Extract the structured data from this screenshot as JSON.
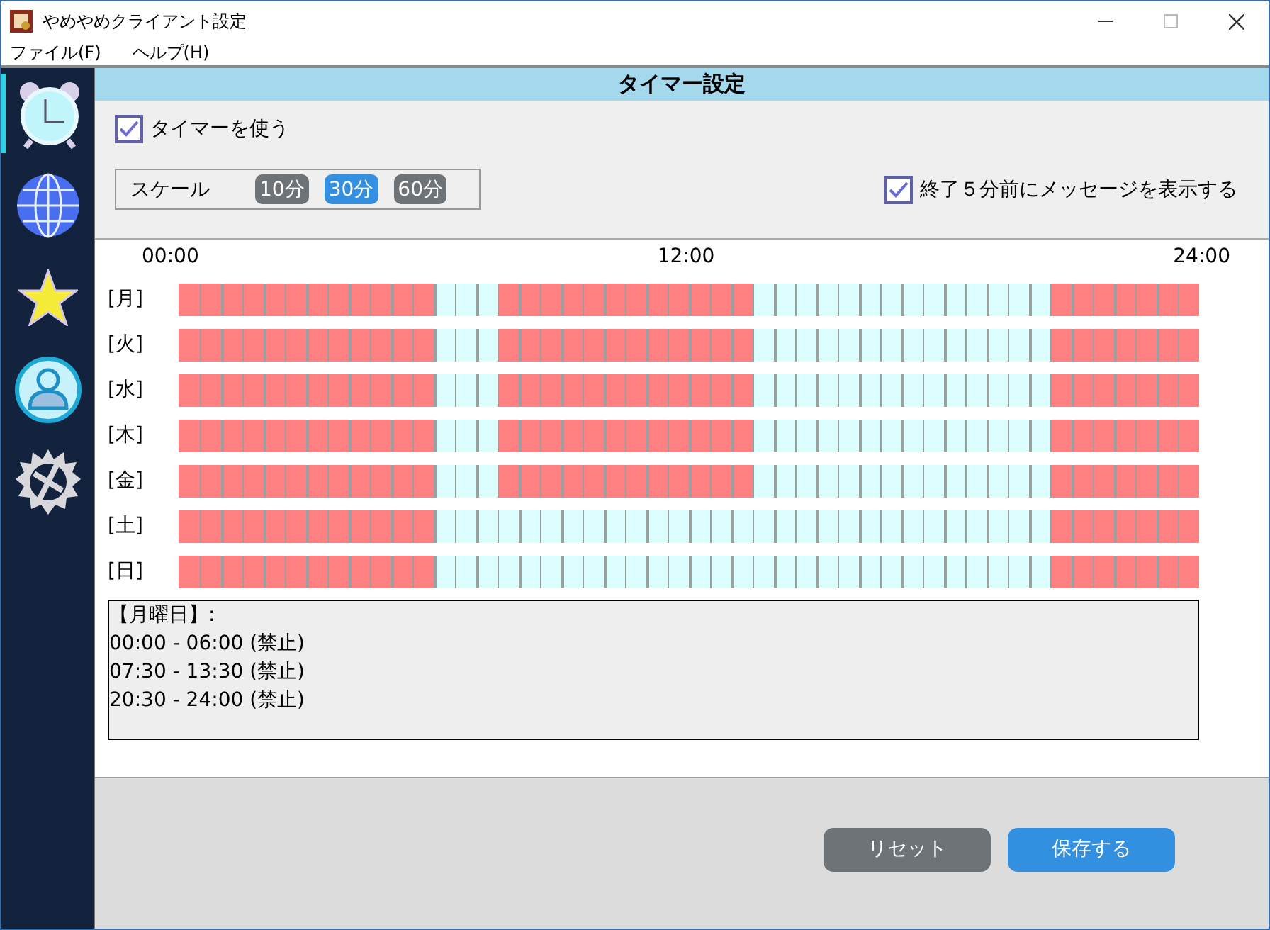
{
  "window": {
    "title": "やめやめクライアント設定"
  },
  "menu": [
    "ファイル(F)",
    "ヘルプ(H)"
  ],
  "sidebar": {
    "items": [
      {
        "kind": "clock",
        "selected": true
      },
      {
        "kind": "globe",
        "selected": false
      },
      {
        "kind": "star",
        "selected": false
      },
      {
        "kind": "user",
        "selected": false
      },
      {
        "kind": "gear",
        "selected": false
      }
    ]
  },
  "panel_title": "タイマー設定",
  "use_timer": {
    "label": "タイマーを使う",
    "checked": true
  },
  "scale": {
    "label": "スケール",
    "options": [
      {
        "label": "10分",
        "selected": false
      },
      {
        "label": "30分",
        "selected": true
      },
      {
        "label": "60分",
        "selected": false
      }
    ]
  },
  "warn_message": {
    "label": "終了５分前にメッセージを表示する",
    "checked": true
  },
  "time_labels": [
    "00:00",
    "12:00",
    "24:00"
  ],
  "days": [
    {
      "label": "[月]",
      "cells": [
        true,
        true,
        true,
        true,
        true,
        true,
        true,
        true,
        true,
        true,
        true,
        true,
        false,
        false,
        false,
        true,
        true,
        true,
        true,
        true,
        true,
        true,
        true,
        true,
        true,
        true,
        true,
        false,
        false,
        false,
        false,
        false,
        false,
        false,
        false,
        false,
        false,
        false,
        false,
        false,
        false,
        true,
        true,
        true,
        true,
        true,
        true,
        true
      ]
    },
    {
      "label": "[火]",
      "cells": [
        true,
        true,
        true,
        true,
        true,
        true,
        true,
        true,
        true,
        true,
        true,
        true,
        false,
        false,
        false,
        true,
        true,
        true,
        true,
        true,
        true,
        true,
        true,
        true,
        true,
        true,
        true,
        false,
        false,
        false,
        false,
        false,
        false,
        false,
        false,
        false,
        false,
        false,
        false,
        false,
        false,
        true,
        true,
        true,
        true,
        true,
        true,
        true
      ]
    },
    {
      "label": "[水]",
      "cells": [
        true,
        true,
        true,
        true,
        true,
        true,
        true,
        true,
        true,
        true,
        true,
        true,
        false,
        false,
        false,
        true,
        true,
        true,
        true,
        true,
        true,
        true,
        true,
        true,
        true,
        true,
        true,
        false,
        false,
        false,
        false,
        false,
        false,
        false,
        false,
        false,
        false,
        false,
        false,
        false,
        false,
        true,
        true,
        true,
        true,
        true,
        true,
        true
      ]
    },
    {
      "label": "[木]",
      "cells": [
        true,
        true,
        true,
        true,
        true,
        true,
        true,
        true,
        true,
        true,
        true,
        true,
        false,
        false,
        false,
        true,
        true,
        true,
        true,
        true,
        true,
        true,
        true,
        true,
        true,
        true,
        true,
        false,
        false,
        false,
        false,
        false,
        false,
        false,
        false,
        false,
        false,
        false,
        false,
        false,
        false,
        true,
        true,
        true,
        true,
        true,
        true,
        true
      ]
    },
    {
      "label": "[金]",
      "cells": [
        true,
        true,
        true,
        true,
        true,
        true,
        true,
        true,
        true,
        true,
        true,
        true,
        false,
        false,
        false,
        true,
        true,
        true,
        true,
        true,
        true,
        true,
        true,
        true,
        true,
        true,
        true,
        false,
        false,
        false,
        false,
        false,
        false,
        false,
        false,
        false,
        false,
        false,
        false,
        false,
        false,
        true,
        true,
        true,
        true,
        true,
        true,
        true
      ]
    },
    {
      "label": "[土]",
      "cells": [
        true,
        true,
        true,
        true,
        true,
        true,
        true,
        true,
        true,
        true,
        true,
        true,
        false,
        false,
        false,
        false,
        false,
        false,
        false,
        false,
        false,
        false,
        false,
        false,
        false,
        false,
        false,
        false,
        false,
        false,
        false,
        false,
        false,
        false,
        false,
        false,
        false,
        false,
        false,
        false,
        false,
        true,
        true,
        true,
        true,
        true,
        true,
        true
      ]
    },
    {
      "label": "[日]",
      "cells": [
        true,
        true,
        true,
        true,
        true,
        true,
        true,
        true,
        true,
        true,
        true,
        true,
        false,
        false,
        false,
        false,
        false,
        false,
        false,
        false,
        false,
        false,
        false,
        false,
        false,
        false,
        false,
        false,
        false,
        false,
        false,
        false,
        false,
        false,
        false,
        false,
        false,
        false,
        false,
        false,
        false,
        true,
        true,
        true,
        true,
        true,
        true,
        true
      ]
    }
  ],
  "summary": [
    "【月曜日】:",
    "00:00 - 06:00 (禁止)",
    "07:30 - 13:30 (禁止)",
    "20:30 - 24:00 (禁止)"
  ],
  "buttons": [
    {
      "label": "リセット",
      "kind": "secondary"
    },
    {
      "label": "保存する",
      "kind": "primary"
    }
  ]
}
